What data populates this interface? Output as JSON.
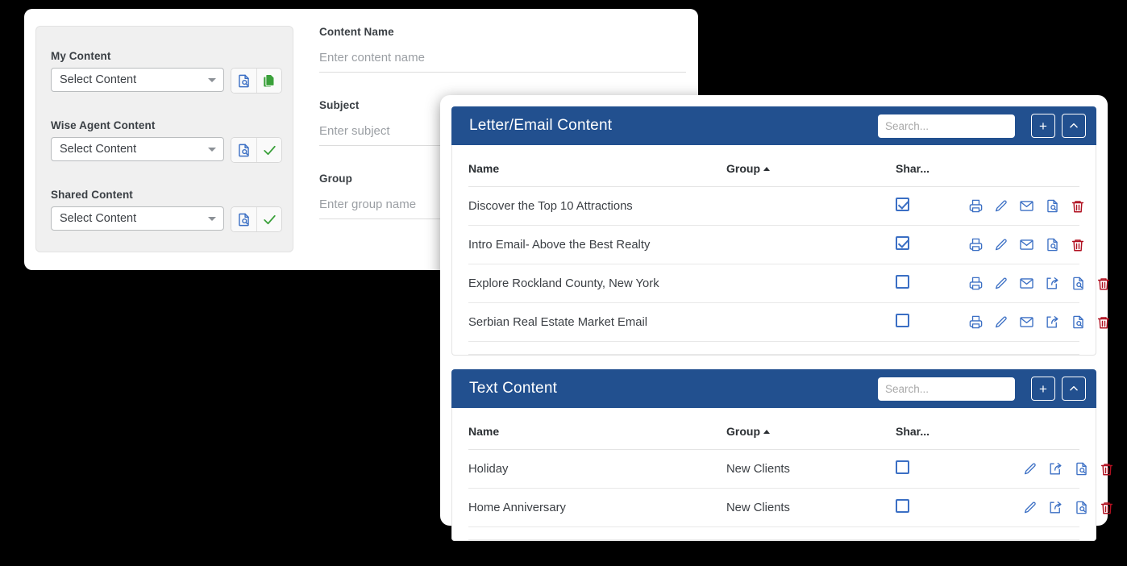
{
  "colors": {
    "panel_header_blue": "#22508f",
    "icon_blue": "#3b6fc4",
    "icon_red": "#b01020",
    "icon_green": "#3aa03a",
    "page_background": "#000000"
  },
  "form": {
    "left_pane": {
      "selectors": [
        {
          "label": "My Content",
          "value": "Select Content",
          "icons": [
            "document-search-icon",
            "copy-content-icon"
          ]
        },
        {
          "label": "Wise Agent Content",
          "value": "Select Content",
          "icons": [
            "document-search-icon",
            "check-icon"
          ]
        },
        {
          "label": "Shared Content",
          "value": "Select Content",
          "icons": [
            "document-search-icon",
            "check-icon"
          ]
        }
      ]
    },
    "fields": [
      {
        "label": "Content Name",
        "value": "",
        "placeholder": "Enter content name"
      },
      {
        "label": "Subject",
        "value": "",
        "placeholder": "Enter subject"
      },
      {
        "label": "Group",
        "value": "",
        "placeholder": "Enter group name"
      }
    ]
  },
  "panels": [
    {
      "title": "Letter/Email Content",
      "search_placeholder": "Search...",
      "add_label": "+",
      "collapse_icon": "chevron-up-icon",
      "columns": [
        "Name",
        "Group",
        "Shar..."
      ],
      "sort_column": "Group",
      "sort_direction": "asc",
      "rows": [
        {
          "name": "Discover the Top 10 Attractions",
          "group": "",
          "shared": true,
          "actions": [
            "print-icon",
            "edit-icon",
            "email-icon",
            "document-search-icon",
            "delete-icon"
          ]
        },
        {
          "name": "Intro Email- Above the Best Realty",
          "group": "",
          "shared": true,
          "actions": [
            "print-icon",
            "edit-icon",
            "email-icon",
            "document-search-icon",
            "delete-icon"
          ]
        },
        {
          "name": "Explore Rockland County, New York",
          "group": "",
          "shared": false,
          "actions": [
            "print-icon",
            "edit-icon",
            "email-icon",
            "share-icon",
            "document-search-icon",
            "delete-icon"
          ]
        },
        {
          "name": "Serbian Real Estate Market Email",
          "group": "",
          "shared": false,
          "actions": [
            "print-icon",
            "edit-icon",
            "email-icon",
            "share-icon",
            "document-search-icon",
            "delete-icon"
          ]
        }
      ]
    },
    {
      "title": "Text Content",
      "search_placeholder": "Search...",
      "add_label": "+",
      "collapse_icon": "chevron-up-icon",
      "columns": [
        "Name",
        "Group",
        "Shar..."
      ],
      "sort_column": "Group",
      "sort_direction": "asc",
      "rows": [
        {
          "name": "Holiday",
          "group": "New Clients",
          "shared": false,
          "actions": [
            "edit-icon",
            "share-icon",
            "document-search-icon",
            "delete-icon"
          ]
        },
        {
          "name": "Home Anniversary",
          "group": "New Clients",
          "shared": false,
          "actions": [
            "edit-icon",
            "share-icon",
            "document-search-icon",
            "delete-icon"
          ]
        }
      ]
    }
  ]
}
